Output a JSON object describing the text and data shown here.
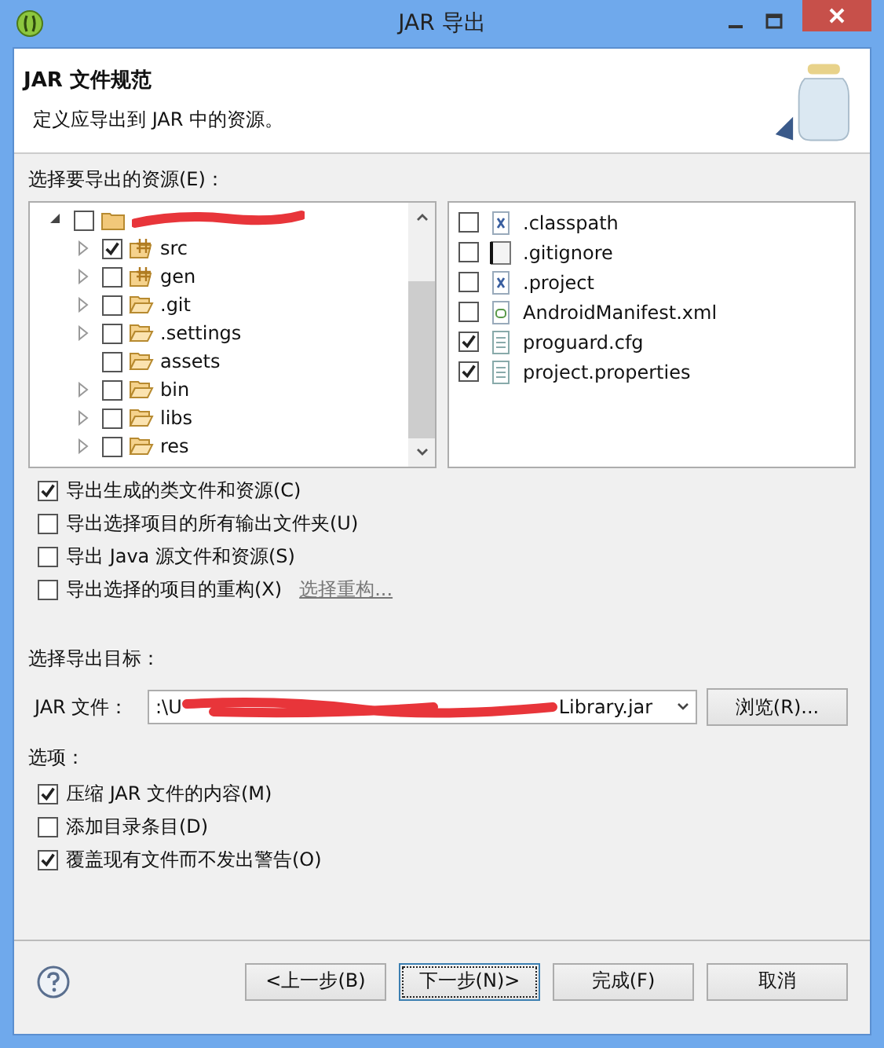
{
  "window": {
    "title": "JAR 导出"
  },
  "header": {
    "title": "JAR 文件规范",
    "description": "定义应导出到 JAR 中的资源。"
  },
  "resources": {
    "label": "选择要导出的资源(E)：",
    "tree": [
      {
        "expanded": true,
        "checked": false,
        "kind": "project",
        "children": [
          {
            "name": "src",
            "checked": true,
            "kind": "package",
            "expandable": true
          },
          {
            "name": "gen",
            "checked": false,
            "kind": "package",
            "expandable": true
          },
          {
            "name": ".git",
            "checked": false,
            "kind": "folder",
            "expandable": true
          },
          {
            "name": ".settings",
            "checked": false,
            "kind": "folder",
            "expandable": true
          },
          {
            "name": "assets",
            "checked": false,
            "kind": "folder",
            "expandable": false
          },
          {
            "name": "bin",
            "checked": false,
            "kind": "folder",
            "expandable": true
          },
          {
            "name": "libs",
            "checked": false,
            "kind": "folder",
            "expandable": true
          },
          {
            "name": "res",
            "checked": false,
            "kind": "folder",
            "expandable": true
          }
        ]
      }
    ],
    "files": [
      {
        "name": ".classpath",
        "checked": false,
        "kind": "xml"
      },
      {
        "name": ".gitignore",
        "checked": false,
        "kind": "text"
      },
      {
        "name": ".project",
        "checked": false,
        "kind": "xml"
      },
      {
        "name": "AndroidManifest.xml",
        "checked": false,
        "kind": "manifest"
      },
      {
        "name": "proguard.cfg",
        "checked": true,
        "kind": "doc"
      },
      {
        "name": "project.properties",
        "checked": true,
        "kind": "doc"
      }
    ]
  },
  "export_options": [
    {
      "label": "导出生成的类文件和资源(C)",
      "checked": true
    },
    {
      "label": "导出选择项目的所有输出文件夹(U)",
      "checked": false
    },
    {
      "label": "导出 Java 源文件和资源(S)",
      "checked": false
    },
    {
      "label": "导出选择的项目的重构(X)",
      "checked": false,
      "link": "选择重构..."
    }
  ],
  "destination": {
    "label": "选择导出目标：",
    "field_label": "JAR 文件：",
    "value_start": ":\\U",
    "value_end": "Library.jar",
    "browse": "浏览(R)..."
  },
  "options": {
    "label": "选项：",
    "items": [
      {
        "label": "压缩 JAR 文件的内容(M)",
        "checked": true
      },
      {
        "label": "添加目录条目(D)",
        "checked": false
      },
      {
        "label": "覆盖现有文件而不发出警告(O)",
        "checked": true
      }
    ]
  },
  "buttons": [
    {
      "label": "<上一步(B)",
      "focused": false
    },
    {
      "label": "下一步(N)>",
      "focused": true
    },
    {
      "label": "完成(F)",
      "focused": false
    },
    {
      "label": "取消",
      "focused": false
    }
  ]
}
